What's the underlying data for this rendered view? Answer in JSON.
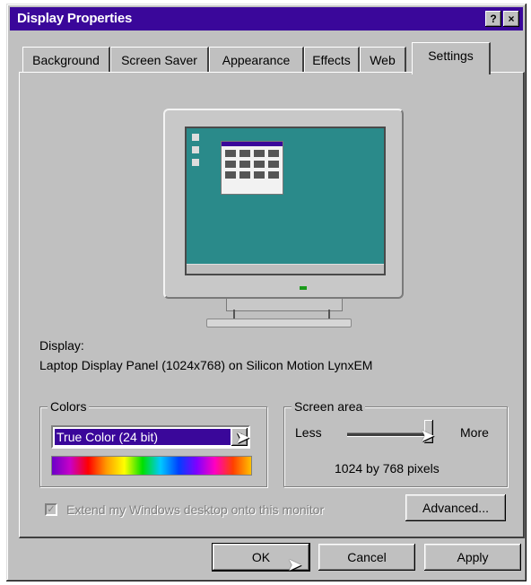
{
  "window": {
    "title": "Display Properties",
    "help_button": "?",
    "close_button": "×",
    "accent": "#3a079a"
  },
  "tabs": [
    {
      "label": "Background"
    },
    {
      "label": "Screen Saver"
    },
    {
      "label": "Appearance"
    },
    {
      "label": "Effects"
    },
    {
      "label": "Web"
    },
    {
      "label": "Settings"
    }
  ],
  "active_tab": "Settings",
  "display": {
    "label": "Display:",
    "value": "Laptop Display Panel (1024x768) on Silicon Motion LynxEM"
  },
  "colors": {
    "legend": "Colors",
    "selected": "True Color (24 bit)"
  },
  "screen_area": {
    "legend": "Screen area",
    "less_label": "Less",
    "more_label": "More",
    "resolution_text": "1024 by 768 pixels"
  },
  "extend": {
    "checkbox_label": "Extend my Windows desktop onto this monitor",
    "checked": true,
    "enabled": false
  },
  "buttons": {
    "advanced": "Advanced...",
    "ok": "OK",
    "cancel": "Cancel",
    "apply": "Apply"
  }
}
